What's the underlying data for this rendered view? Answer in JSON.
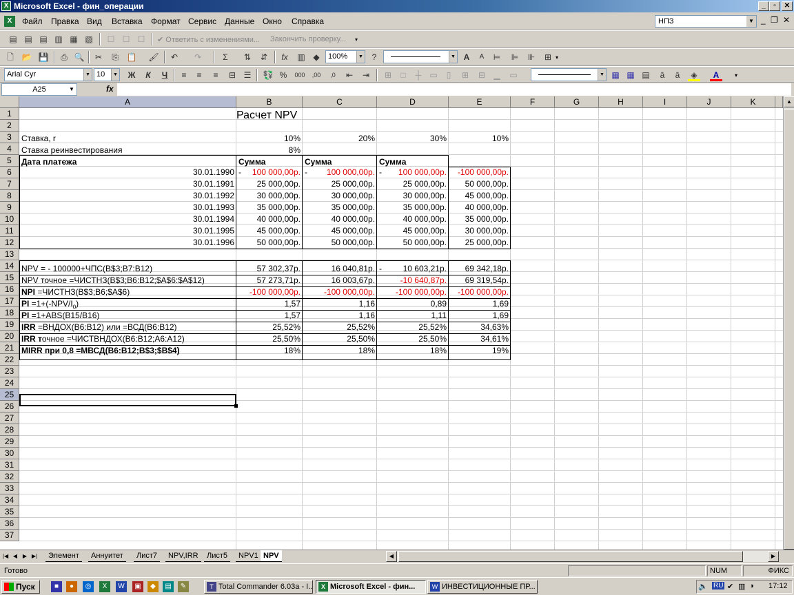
{
  "window": {
    "title": "Microsoft Excel - фин_операции",
    "min": "_",
    "max": "▫",
    "close": "✕"
  },
  "menu": {
    "items": [
      "Файл",
      "Правка",
      "Вид",
      "Вставка",
      "Формат",
      "Сервис",
      "Данные",
      "Окно",
      "Справка"
    ],
    "help_box": "НПЗ"
  },
  "toolbar_review": {
    "reply": "Ответить с изменениями...",
    "end_review": "Закончить проверку..."
  },
  "toolbar_standard": {
    "zoom": "100%"
  },
  "toolbar_format": {
    "font": "Arial Cyr",
    "size": "10",
    "bold": "Ж",
    "italic": "К",
    "underline": "Ч"
  },
  "formula_bar": {
    "name_box": "A25",
    "fx": "fx",
    "content": ""
  },
  "columns": [
    "A",
    "B",
    "C",
    "D",
    "E",
    "F",
    "G",
    "H",
    "I",
    "J",
    "K"
  ],
  "selected_col": "A",
  "selected_row": "25",
  "rows": [
    "1",
    "2",
    "3",
    "4",
    "5",
    "6",
    "7",
    "8",
    "9",
    "10",
    "11",
    "12",
    "13",
    "14",
    "15",
    "16",
    "17",
    "18",
    "19",
    "20",
    "21",
    "22",
    "23",
    "24",
    "25",
    "26",
    "27",
    "28",
    "29",
    "30",
    "31",
    "32",
    "33",
    "34",
    "35",
    "36",
    "37"
  ],
  "sheet": {
    "title": "Расчет NPV",
    "rate_label": "Ставка, r",
    "reinv_label": "Ставка реинвестирования",
    "rates": [
      "10%",
      "20%",
      "30%",
      "10%"
    ],
    "reinv_rate": "8%",
    "date_header": "Дата платежа",
    "sum_header": "Сумма",
    "dates": [
      "30.01.1990",
      "30.01.1991",
      "30.01.1992",
      "30.01.1993",
      "30.01.1994",
      "30.01.1995",
      "30.01.1996"
    ],
    "cashflows": [
      [
        "100 000,00р.",
        "100 000,00р.",
        "100 000,00р.",
        "-100 000,00р."
      ],
      [
        "25 000,00р.",
        "25 000,00р.",
        "25 000,00р.",
        "50 000,00р."
      ],
      [
        "30 000,00р.",
        "30 000,00р.",
        "30 000,00р.",
        "45 000,00р."
      ],
      [
        "35 000,00р.",
        "35 000,00р.",
        "35 000,00р.",
        "40 000,00р."
      ],
      [
        "40 000,00р.",
        "40 000,00р.",
        "40 000,00р.",
        "35 000,00р."
      ],
      [
        "45 000,00р.",
        "45 000,00р.",
        "45 000,00р.",
        "30 000,00р."
      ],
      [
        "50 000,00р.",
        "50 000,00р.",
        "50 000,00р.",
        "25 000,00р."
      ]
    ],
    "dash": "-",
    "results": [
      {
        "label": "NPV = - 100000+ЧПС(B$3;B7:B12)",
        "values": [
          "57 302,37р.",
          "16 040,81р.",
          "10 603,21р.",
          "69 342,18р."
        ]
      },
      {
        "label": "NPV точное =ЧИСТНЗ(B$3;B6:B12;$A$6:$A$12)",
        "values": [
          "57 273,71р.",
          "16 003,67р.",
          "-10 640,87р.",
          "69 319,54р."
        ]
      },
      {
        "label_bold": "NPI",
        "label": " =ЧИСТНЗ(B$3;B6;$A$6)",
        "values": [
          "-100 000,00р.",
          "-100 000,00р.",
          "-100 000,00р.",
          "-100 000,00р."
        ]
      },
      {
        "label_bold": "PI",
        "label": " =1+(-NPV/I",
        "label_sub": "0",
        "label_end": ")",
        "values": [
          "1,57",
          "1,16",
          "0,89",
          "1,69"
        ]
      },
      {
        "label_bold": "PI",
        "label": " =1+ABS(B15/B16)",
        "values": [
          "1,57",
          "1,16",
          "1,11",
          "1,69"
        ]
      },
      {
        "label_bold": "IRR",
        "label": " =ВНДОХ(B6:B12) или  =ВСД(B6:B12)",
        "values": [
          "25,52%",
          "25,52%",
          "25,52%",
          "34,63%"
        ]
      },
      {
        "label_bold": "IRR т",
        "label": "очное =ЧИСТВНДОХ(B6:B12;A6:A12)",
        "values": [
          "25,50%",
          "25,50%",
          "25,50%",
          "34,61%"
        ]
      },
      {
        "label_bold": "MIRR при 0,8 =МВСД(B6:B12;B$3;$B$4)",
        "label": "",
        "values": [
          "18%",
          "18%",
          "18%",
          "19%"
        ]
      }
    ]
  },
  "sheet_tabs": [
    "Элемент",
    "Аннуитет",
    "Лист7",
    "NPV,IRR",
    "Лист5",
    "NPV1",
    "NPV"
  ],
  "active_tab": "NPV",
  "status": {
    "ready": "Готово",
    "num": "NUM",
    "fix": "ФИКС"
  },
  "taskbar": {
    "start": "Пуск",
    "tasks": [
      "Total Commander 6.03a - I...",
      "Microsoft Excel - фин...",
      "ИНВЕСТИЦИОННЫЕ ПР..."
    ],
    "lang": "RU",
    "time": "17:12"
  },
  "colors": {
    "title_bar": "#0a246a",
    "negative": "#e00000",
    "excel_green": "#1d7a3a",
    "selection_header": "#b6bdd2"
  }
}
